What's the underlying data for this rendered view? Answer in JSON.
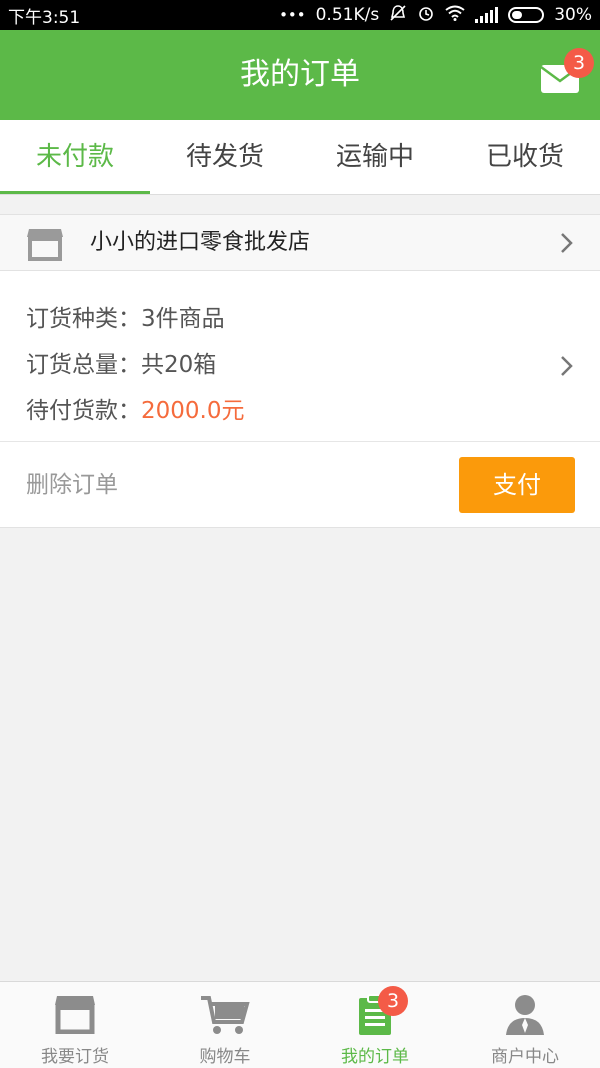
{
  "status_bar": {
    "time": "下午3:51",
    "net_speed": "0.51K/s",
    "battery": "30%"
  },
  "header": {
    "title": "我的订单",
    "mail_badge": "3"
  },
  "tabs": [
    {
      "label": "未付款",
      "active": true
    },
    {
      "label": "待发货",
      "active": false
    },
    {
      "label": "运输中",
      "active": false
    },
    {
      "label": "已收货",
      "active": false
    }
  ],
  "order": {
    "shop_name": "小小的进口零食批发店",
    "type_label": "订货种类：",
    "type_value": "3件商品",
    "qty_label": "订货总量：",
    "qty_value": "共20箱",
    "pay_label": "待付货款：",
    "pay_value": "2000.0元",
    "delete_label": "删除订单",
    "pay_button": "支付"
  },
  "bottom_nav": [
    {
      "label": "我要订货",
      "icon": "store-icon"
    },
    {
      "label": "购物车",
      "icon": "cart-icon"
    },
    {
      "label": "我的订单",
      "icon": "order-list-icon",
      "badge": "3",
      "active": true
    },
    {
      "label": "商户中心",
      "icon": "user-icon"
    }
  ],
  "colors": {
    "brand_green": "#5cb948",
    "pay_orange": "#fb9a0b",
    "price_red": "#f56b3c",
    "badge_red": "#f45b47"
  }
}
